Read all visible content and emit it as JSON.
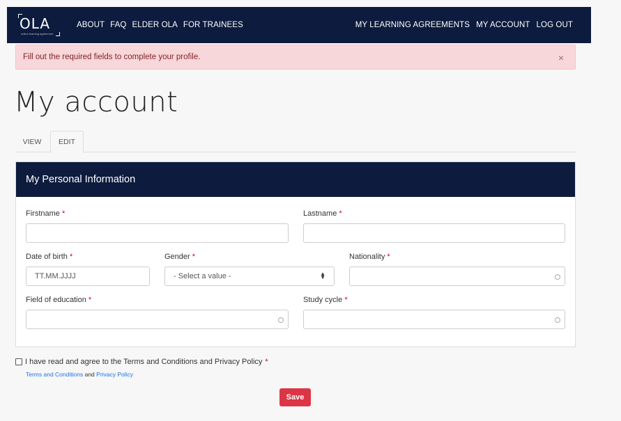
{
  "nav": {
    "logo_text": "OLA",
    "logo_sub": "online learning agreement",
    "left": [
      "ABOUT",
      "FAQ",
      "ELDER OLA",
      "FOR TRAINEES"
    ],
    "right": [
      "MY LEARNING AGREEMENTS",
      "MY ACCOUNT",
      "LOG OUT"
    ]
  },
  "alert": {
    "message": "Fill out the required fields to complete your profile.",
    "close": "×"
  },
  "page_title": "My account",
  "tabs": {
    "view": "VIEW",
    "edit": "EDIT"
  },
  "section": {
    "title": "My Personal Information",
    "required_mark": "*",
    "firstname_label": "Firstname",
    "lastname_label": "Lastname",
    "dob_label": "Date of birth",
    "dob_placeholder": "TT.MM.JJJJ",
    "gender_label": "Gender",
    "gender_value": "- Select a value -",
    "nationality_label": "Nationality",
    "field_label": "Field of education",
    "cycle_label": "Study cycle"
  },
  "agreement": {
    "text": "I have read and agree to the Terms and Conditions and Privacy Policy",
    "terms_link": "Terms and Conditions",
    "and": "and",
    "privacy_link": "Privacy Policy"
  },
  "save_label": "Save"
}
